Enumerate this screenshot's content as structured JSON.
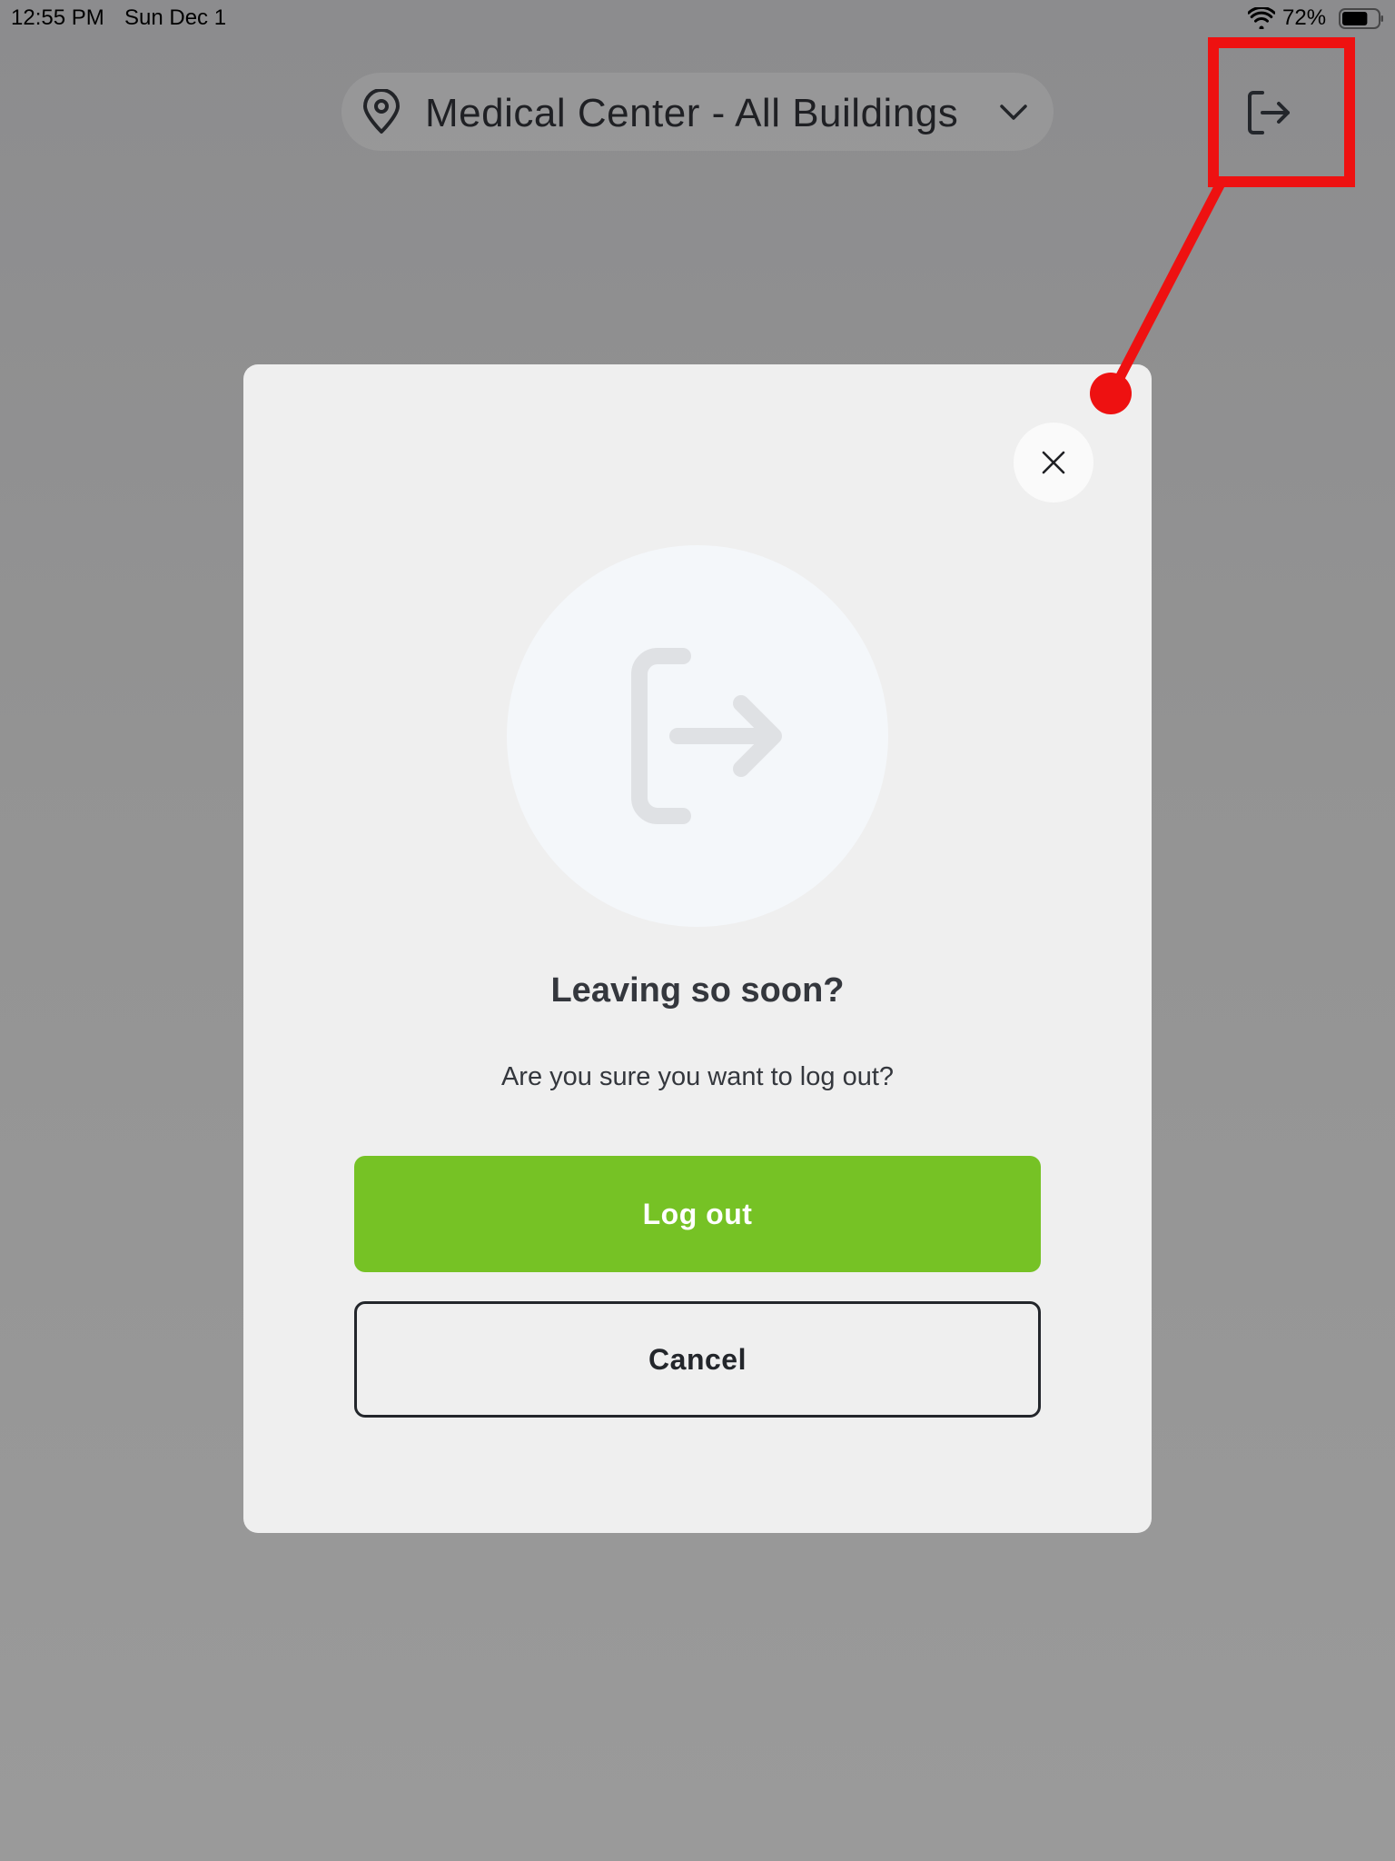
{
  "status_bar": {
    "time": "12:55 PM",
    "date": "Sun Dec 1",
    "battery_percent": "72%",
    "battery_level": 0.72,
    "icons": [
      "wifi-icon",
      "battery-icon"
    ]
  },
  "header": {
    "location_label": "Medical Center - All Buildings",
    "icons": [
      "location-pin-icon",
      "chevron-down-icon",
      "logout-icon"
    ]
  },
  "modal": {
    "title": "Leaving so soon?",
    "message": "Are you sure you want to log out?",
    "logout_label": "Log out",
    "cancel_label": "Cancel",
    "icons": [
      "close-icon",
      "logout-icon"
    ]
  },
  "colors": {
    "primary_green": "#76c225",
    "annotation_red": "#ee1111",
    "modal_background": "#efefef",
    "text_dark": "#34373d"
  }
}
